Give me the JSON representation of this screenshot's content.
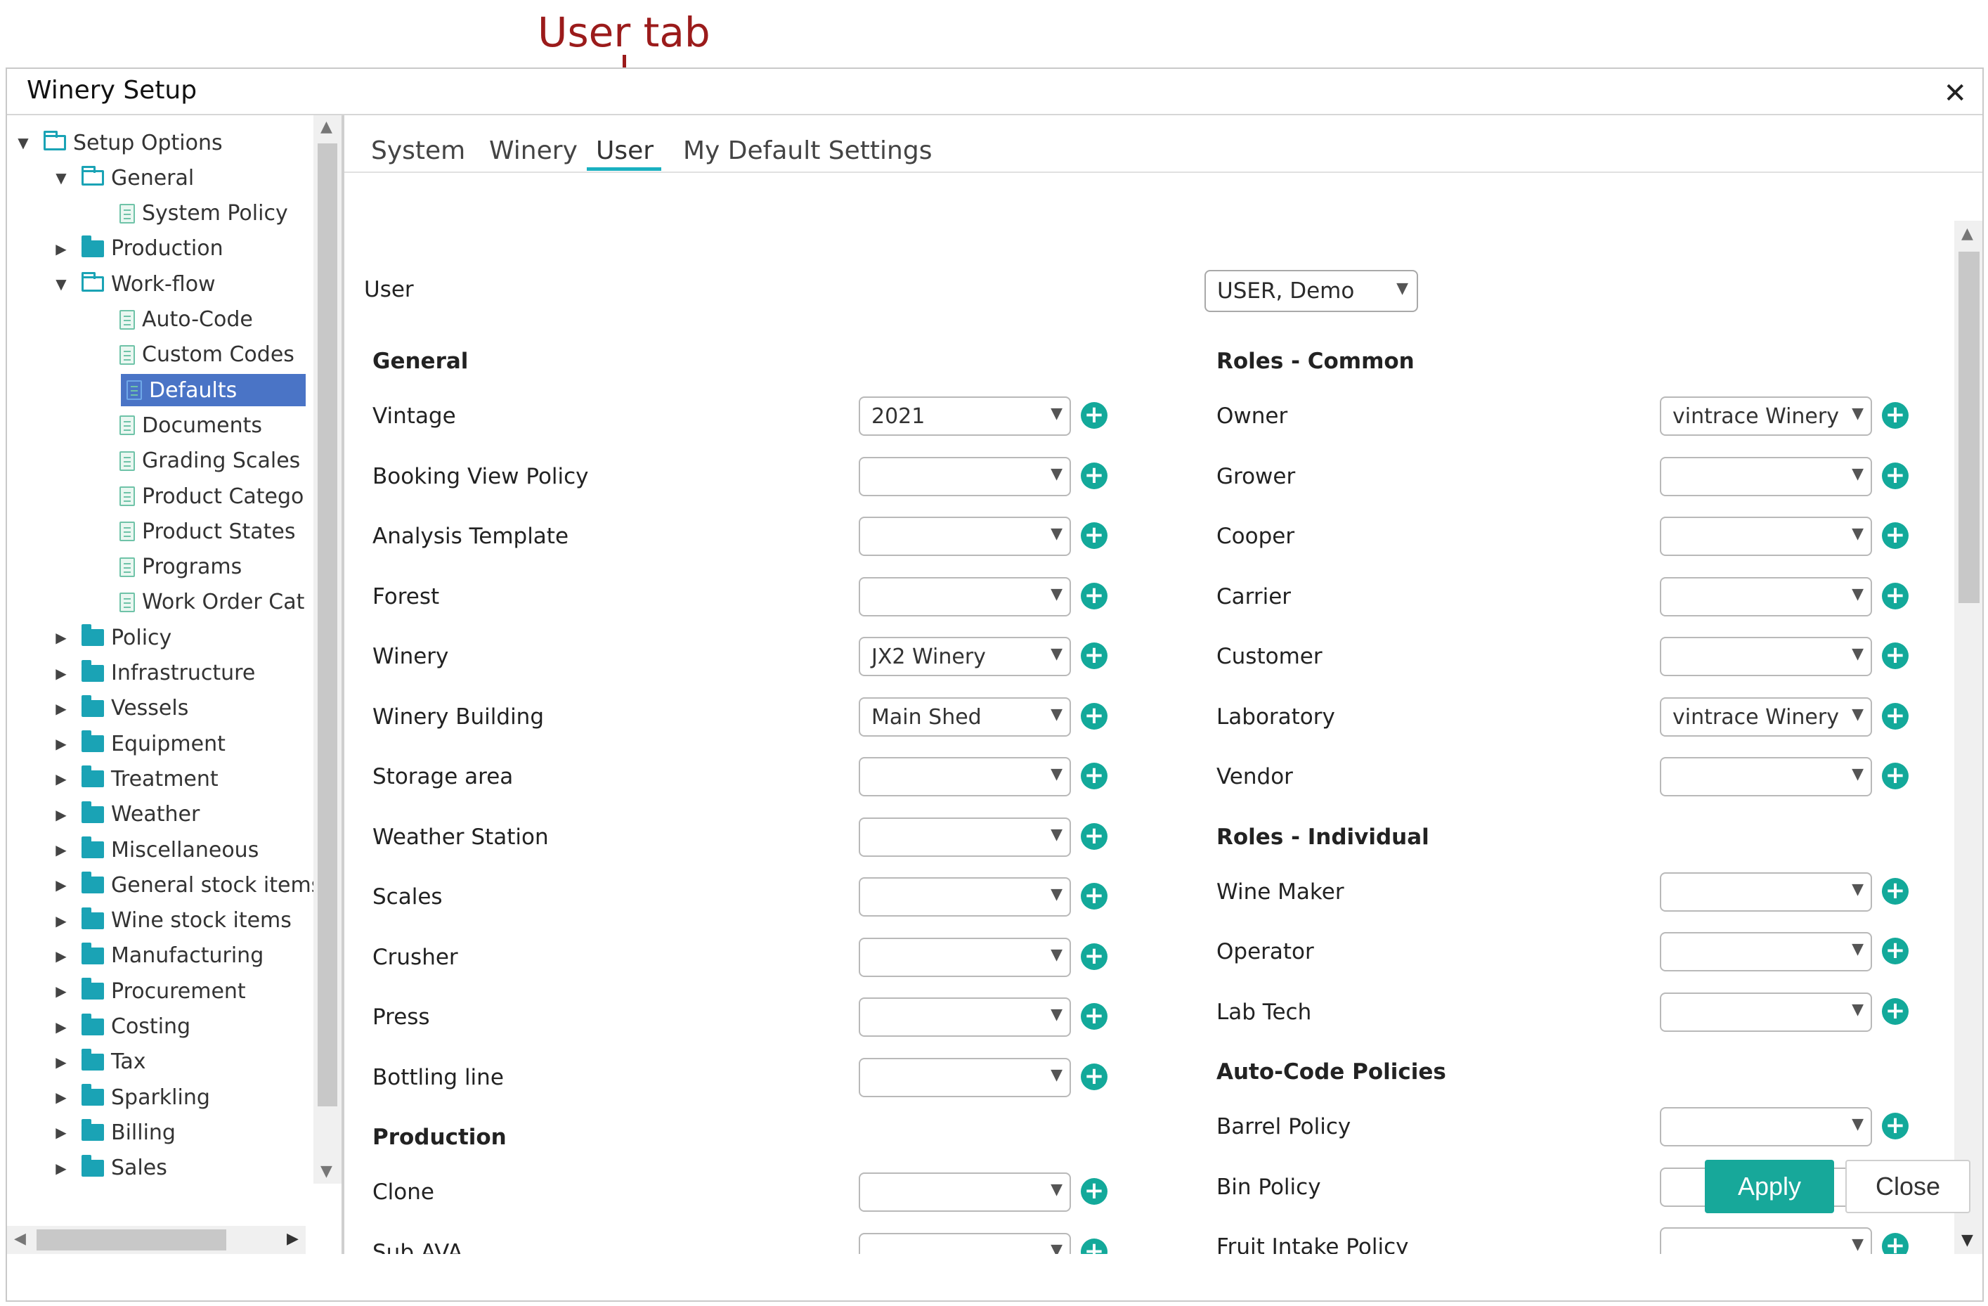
{
  "annotation": {
    "label": "User tab"
  },
  "dialog": {
    "title": "Winery Setup"
  },
  "tree": {
    "items": [
      {
        "label": "Setup Options",
        "level": 0,
        "toggle": "open",
        "icon": "folder-open-icon"
      },
      {
        "label": "General",
        "level": 1,
        "toggle": "open",
        "icon": "folder-open-icon"
      },
      {
        "label": "System Policy",
        "level": 2,
        "toggle": "none",
        "icon": "document-icon"
      },
      {
        "label": "Production",
        "level": 1,
        "toggle": "closed",
        "icon": "folder-icon"
      },
      {
        "label": "Work-flow",
        "level": 1,
        "toggle": "open",
        "icon": "folder-open-icon"
      },
      {
        "label": "Auto-Code",
        "level": 2,
        "toggle": "none",
        "icon": "document-icon"
      },
      {
        "label": "Custom Codes",
        "level": 2,
        "toggle": "none",
        "icon": "document-icon"
      },
      {
        "label": "Defaults",
        "level": 2,
        "toggle": "none",
        "icon": "document-icon",
        "selected": true
      },
      {
        "label": "Documents",
        "level": 2,
        "toggle": "none",
        "icon": "document-icon"
      },
      {
        "label": "Grading Scales",
        "level": 2,
        "toggle": "none",
        "icon": "document-icon"
      },
      {
        "label": "Product Catego",
        "level": 2,
        "toggle": "none",
        "icon": "document-icon"
      },
      {
        "label": "Product States",
        "level": 2,
        "toggle": "none",
        "icon": "document-icon"
      },
      {
        "label": "Programs",
        "level": 2,
        "toggle": "none",
        "icon": "document-icon"
      },
      {
        "label": "Work Order Cat",
        "level": 2,
        "toggle": "none",
        "icon": "document-icon"
      },
      {
        "label": "Policy",
        "level": 1,
        "toggle": "closed",
        "icon": "folder-icon"
      },
      {
        "label": "Infrastructure",
        "level": 1,
        "toggle": "closed",
        "icon": "folder-icon"
      },
      {
        "label": "Vessels",
        "level": 1,
        "toggle": "closed",
        "icon": "folder-icon"
      },
      {
        "label": "Equipment",
        "level": 1,
        "toggle": "closed",
        "icon": "folder-icon"
      },
      {
        "label": "Treatment",
        "level": 1,
        "toggle": "closed",
        "icon": "folder-icon"
      },
      {
        "label": "Weather",
        "level": 1,
        "toggle": "closed",
        "icon": "folder-icon"
      },
      {
        "label": "Miscellaneous",
        "level": 1,
        "toggle": "closed",
        "icon": "folder-icon"
      },
      {
        "label": "General stock items",
        "level": 1,
        "toggle": "closed",
        "icon": "folder-icon"
      },
      {
        "label": "Wine stock items",
        "level": 1,
        "toggle": "closed",
        "icon": "folder-icon"
      },
      {
        "label": "Manufacturing",
        "level": 1,
        "toggle": "closed",
        "icon": "folder-icon"
      },
      {
        "label": "Procurement",
        "level": 1,
        "toggle": "closed",
        "icon": "folder-icon"
      },
      {
        "label": "Costing",
        "level": 1,
        "toggle": "closed",
        "icon": "folder-icon"
      },
      {
        "label": "Tax",
        "level": 1,
        "toggle": "closed",
        "icon": "folder-icon"
      },
      {
        "label": "Sparkling",
        "level": 1,
        "toggle": "closed",
        "icon": "folder-icon"
      },
      {
        "label": "Billing",
        "level": 1,
        "toggle": "closed",
        "icon": "folder-icon"
      },
      {
        "label": "Sales",
        "level": 1,
        "toggle": "closed",
        "icon": "folder-icon"
      }
    ]
  },
  "tabs": [
    {
      "label": "System",
      "active": false
    },
    {
      "label": "Winery",
      "active": false
    },
    {
      "label": "User",
      "active": true
    },
    {
      "label": "My Default Settings",
      "active": false
    }
  ],
  "user": {
    "label": "User",
    "value": "USER, Demo"
  },
  "left_column": {
    "sections": [
      {
        "header": "General",
        "fields": [
          {
            "label": "Vintage",
            "value": "2021"
          },
          {
            "label": "Booking View Policy",
            "value": ""
          },
          {
            "label": "Analysis Template",
            "value": ""
          },
          {
            "label": "Forest",
            "value": ""
          },
          {
            "label": "Winery",
            "value": "JX2 Winery"
          },
          {
            "label": "Winery Building",
            "value": "Main Shed"
          },
          {
            "label": "Storage area",
            "value": ""
          },
          {
            "label": "Weather Station",
            "value": ""
          },
          {
            "label": "Scales",
            "value": ""
          },
          {
            "label": "Crusher",
            "value": ""
          },
          {
            "label": "Press",
            "value": ""
          },
          {
            "label": "Bottling line",
            "value": ""
          }
        ]
      },
      {
        "header": "Production",
        "fields": [
          {
            "label": "Clone",
            "value": ""
          },
          {
            "label": "Sub AVA",
            "value": ""
          }
        ]
      }
    ]
  },
  "right_column": {
    "sections": [
      {
        "header": "Roles - Common",
        "fields": [
          {
            "label": "Owner",
            "value": "vintrace Winery"
          },
          {
            "label": "Grower",
            "value": ""
          },
          {
            "label": "Cooper",
            "value": ""
          },
          {
            "label": "Carrier",
            "value": ""
          },
          {
            "label": "Customer",
            "value": ""
          },
          {
            "label": "Laboratory",
            "value": "vintrace Winery"
          },
          {
            "label": "Vendor",
            "value": ""
          }
        ]
      },
      {
        "header": "Roles - Individual",
        "fields": [
          {
            "label": "Wine Maker",
            "value": ""
          },
          {
            "label": "Operator",
            "value": ""
          },
          {
            "label": "Lab Tech",
            "value": ""
          }
        ]
      },
      {
        "header": "Auto-Code Policies",
        "fields": [
          {
            "label": "Barrel Policy",
            "value": ""
          },
          {
            "label": "Bin Policy",
            "value": ""
          },
          {
            "label": "Fruit Intake Policy",
            "value": ""
          }
        ]
      }
    ]
  },
  "footer": {
    "apply_label": "Apply",
    "close_label": "Close"
  },
  "colors": {
    "accent": "#13a99a",
    "selected": "#4a74c6",
    "annotation": "#9b1b1b"
  }
}
